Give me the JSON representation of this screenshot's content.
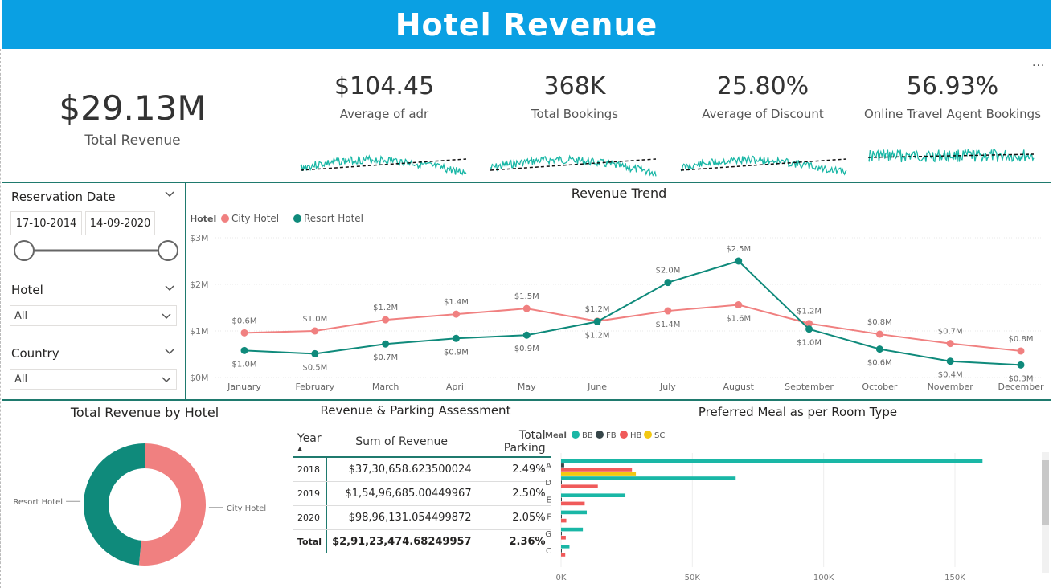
{
  "header": {
    "title": "Hotel Revenue"
  },
  "kpis": {
    "total_revenue": {
      "value": "$29.13M",
      "label": "Total Revenue"
    },
    "adr": {
      "value": "$104.45",
      "label": "Average of adr"
    },
    "bookings": {
      "value": "368K",
      "label": "Total Bookings"
    },
    "discount": {
      "value": "25.80%",
      "label": "Average of Discount"
    },
    "ota": {
      "value": "56.93%",
      "label": "Online Travel Agent Bookings"
    }
  },
  "slicers": {
    "reservation_date": {
      "title": "Reservation Date",
      "start": "17-10-2014",
      "end": "14-09-2020"
    },
    "hotel": {
      "title": "Hotel",
      "value": "All"
    },
    "country": {
      "title": "Country",
      "value": "All"
    }
  },
  "more_options": "...",
  "colors": {
    "header": "#0aa0e3",
    "city": "#f08080",
    "resort": "#0f8a7b",
    "bb": "#1ab7a6",
    "fb": "#374649",
    "hb": "#f05a5a",
    "sc": "#f2c811",
    "divider": "#1f7a6e"
  },
  "chart_data": [
    {
      "type": "line",
      "title": "Revenue Trend",
      "legend_title": "Hotel",
      "legend_position": "top-left",
      "categories": [
        "January",
        "February",
        "March",
        "April",
        "May",
        "June",
        "July",
        "August",
        "September",
        "October",
        "November",
        "December"
      ],
      "series": [
        {
          "name": "City Hotel",
          "values": [
            0.96,
            1.0,
            1.24,
            1.36,
            1.48,
            1.21,
            1.43,
            1.56,
            1.16,
            0.93,
            0.73,
            0.57
          ],
          "labels": [
            "$0.6M",
            "$1.0M",
            "$1.2M",
            "$1.4M",
            "$1.5M",
            "$1.2M",
            "$1.4M",
            "$1.6M",
            "$1.2M",
            "$0.8M",
            "$0.7M",
            "$0.8M"
          ]
        },
        {
          "name": "Resort Hotel",
          "values": [
            0.58,
            0.51,
            0.72,
            0.84,
            0.91,
            1.2,
            2.04,
            2.5,
            1.04,
            0.61,
            0.35,
            0.27
          ],
          "labels": [
            "$1.0M",
            "$0.5M",
            "$0.7M",
            "$0.9M",
            "$0.9M",
            "$1.2M",
            "$2.0M",
            "$2.5M",
            "$1.0M",
            "$0.6M",
            "$0.4M",
            "$0.3M"
          ]
        }
      ],
      "yticks": [
        "$0M",
        "$1M",
        "$2M",
        "$3M"
      ],
      "ylim": [
        0,
        3
      ],
      "grid": true
    },
    {
      "type": "pie",
      "title": "Total Revenue by Hotel",
      "donut": true,
      "slices": [
        {
          "name": "City Hotel",
          "value": 51.5
        },
        {
          "name": "Resort Hotel",
          "value": 48.5
        }
      ]
    },
    {
      "type": "table",
      "title": "Revenue & Parking Assessment",
      "columns": [
        "Year",
        "Sum of Revenue",
        "Total Parking"
      ],
      "rows": [
        [
          "2018",
          "$37,30,658.623500024",
          "2.49%"
        ],
        [
          "2019",
          "$1,54,96,685.00449967",
          "2.50%"
        ],
        [
          "2020",
          "$98,96,131.054499872",
          "2.05%"
        ]
      ],
      "total": [
        "Total",
        "$2,91,23,474.68249957",
        "2.36%"
      ]
    },
    {
      "type": "bar",
      "orientation": "horizontal",
      "title": "Preferred Meal as per Room Type",
      "legend_title": "Meal",
      "legend_position": "top-left",
      "categories": [
        "A",
        "D",
        "E",
        "F",
        "G",
        "C"
      ],
      "series": [
        {
          "name": "BB",
          "values": [
            160500,
            66500,
            24500,
            9800,
            8300,
            3200
          ]
        },
        {
          "name": "FB",
          "values": [
            1200,
            300,
            200,
            100,
            100,
            100
          ]
        },
        {
          "name": "HB",
          "values": [
            27000,
            14000,
            9000,
            2000,
            1800,
            1600
          ]
        },
        {
          "name": "SC",
          "values": [
            28500,
            0,
            0,
            0,
            0,
            0
          ]
        }
      ],
      "xticks": [
        "0K",
        "50K",
        "100K",
        "150K"
      ],
      "xlim": [
        0,
        165000
      ],
      "grid": true
    }
  ]
}
